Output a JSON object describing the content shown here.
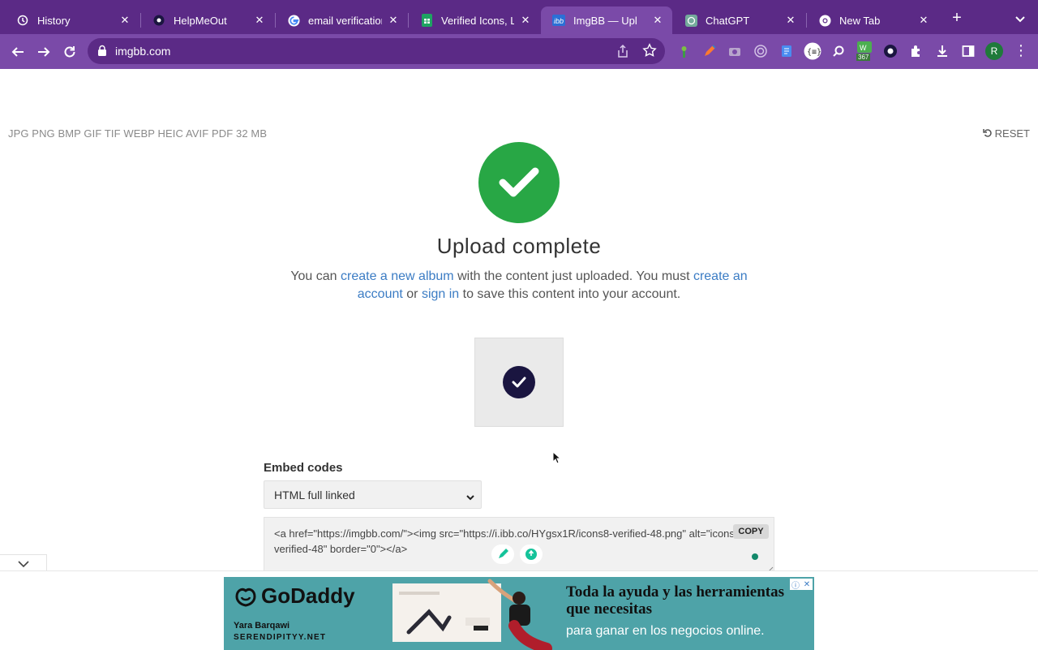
{
  "browser": {
    "tabs": [
      {
        "title": "History",
        "icon": "history-icon"
      },
      {
        "title": "HelpMeOut",
        "icon": "record-icon"
      },
      {
        "title": "email verification",
        "icon": "google-icon"
      },
      {
        "title": "Verified Icons, Lo",
        "icon": "sheets-icon"
      },
      {
        "title": "ImgBB — Upl",
        "icon": "imgbb-icon",
        "active": true
      },
      {
        "title": "ChatGPT",
        "icon": "chatgpt-icon"
      },
      {
        "title": "New Tab",
        "icon": "chrome-icon"
      }
    ],
    "url": "imgbb.com",
    "extension_badge": "367",
    "profile_initial": "R",
    "accent": "#7a4aa8",
    "tabstrip_color": "#5b2a86"
  },
  "page": {
    "formats": "JPG PNG BMP GIF TIF WEBP HEIC AVIF PDF   32 MB",
    "reset_label": "RESET",
    "heading": "Upload complete",
    "desc": {
      "p1": "You can ",
      "link_album": "create a new album",
      "p2": " with the content just uploaded. You must ",
      "link_account": "create an account",
      "p3": " or ",
      "link_signin": "sign in",
      "p4": " to save this content into your account."
    },
    "embed_label": "Embed codes",
    "embed_selected": "HTML full linked",
    "embed_code": "<a href=\"https://imgbb.com/\"><img src=\"https://i.ibb.co/HYgsx1R/icons8-verified-48.png\" alt=\"icons8-verified-48\" border=\"0\"></a>",
    "copy_label": "COPY",
    "success_color": "#28a745"
  },
  "ad": {
    "brand": "GoDaddy",
    "person": "Yara Barqawi",
    "site": "SERENDIPITYY.NET",
    "headline": "Toda la ayuda y las herramientas que necesitas",
    "subline": "para ganar en los negocios online."
  }
}
